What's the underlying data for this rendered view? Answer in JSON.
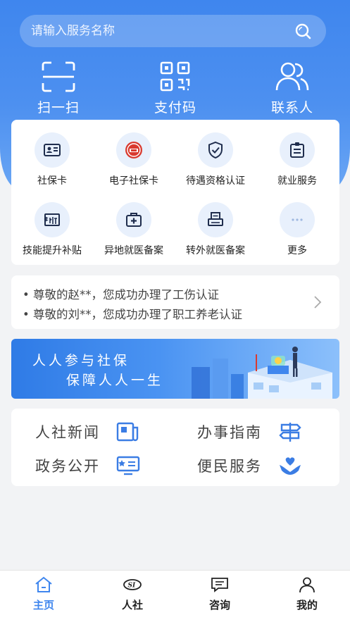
{
  "search": {
    "placeholder": "请输入服务名称"
  },
  "quick_actions": [
    {
      "label": "扫一扫",
      "icon": "scan-icon"
    },
    {
      "label": "支付码",
      "icon": "qrcode-icon"
    },
    {
      "label": "联系人",
      "icon": "contacts-icon"
    }
  ],
  "services": [
    {
      "label": "社保卡",
      "icon": "id-card-icon"
    },
    {
      "label": "电子社保卡",
      "icon": "seal-icon"
    },
    {
      "label": "待遇资格认证",
      "icon": "shield-check-icon"
    },
    {
      "label": "就业服务",
      "icon": "badge-icon"
    },
    {
      "label": "技能提升补贴",
      "icon": "subsidy-ticket-icon"
    },
    {
      "label": "异地就医备案",
      "icon": "medical-kit-icon"
    },
    {
      "label": "转外就医备案",
      "icon": "printer-icon"
    },
    {
      "label": "更多",
      "icon": "more-dots-icon"
    }
  ],
  "notices": [
    "尊敬的赵**，您成功办理了工伤认证",
    "尊敬的刘**，您成功办理了职工养老认证"
  ],
  "banner": {
    "line1": "人人参与社保",
    "line2": "保障人人一生"
  },
  "news": [
    {
      "label": "人社新闻",
      "icon": "newspaper-icon"
    },
    {
      "label": "办事指南",
      "icon": "signpost-icon"
    },
    {
      "label": "政务公开",
      "icon": "monitor-icon"
    },
    {
      "label": "便民服务",
      "icon": "heart-hand-icon"
    }
  ],
  "tabs": [
    {
      "label": "主页",
      "icon": "home-icon",
      "active": true
    },
    {
      "label": "人社",
      "icon": "si-logo-icon"
    },
    {
      "label": "咨询",
      "icon": "chat-icon"
    },
    {
      "label": "我的",
      "icon": "user-icon"
    }
  ],
  "colors": {
    "primary": "#3f86ee",
    "icon_blue": "#3b7de4",
    "page_bg": "#f2f3f5"
  }
}
